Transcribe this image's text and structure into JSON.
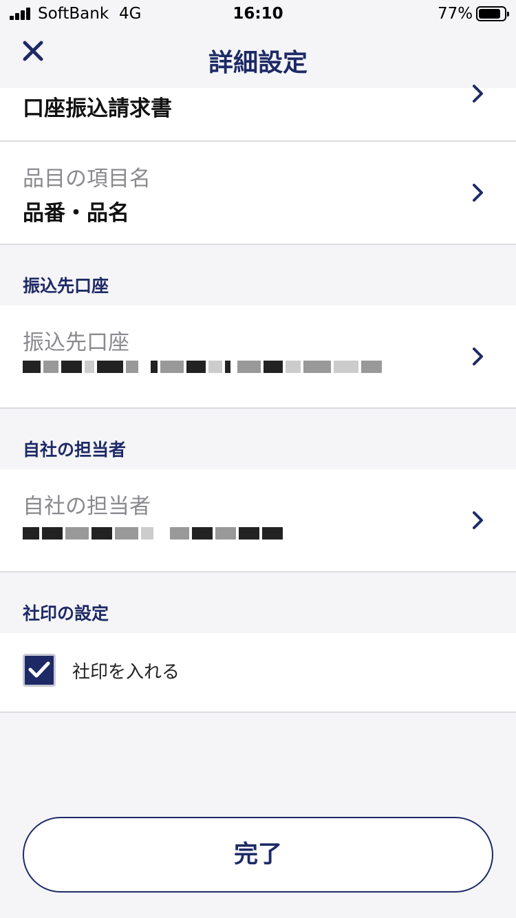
{
  "status_bar": {
    "carrier": "SoftBank",
    "network": "4G",
    "time": "16:10",
    "battery_percent": "77%",
    "battery_level": 0.77
  },
  "nav": {
    "title": "詳細設定",
    "close_icon": "close-icon"
  },
  "rows": {
    "invoice_type": {
      "value": "口座振込請求書"
    },
    "item_field_name": {
      "label": "品目の項目名",
      "value": "品番・品名"
    }
  },
  "sections": {
    "bank_account": {
      "header": "振込先口座",
      "label": "振込先口座",
      "value_redacted": true
    },
    "staff": {
      "header": "自社の担当者",
      "label": "自社の担当者",
      "value_redacted": true
    },
    "seal": {
      "header": "社印の設定",
      "checkbox_label": "社印を入れる",
      "checked": true
    }
  },
  "footer": {
    "done_label": "完了"
  },
  "colors": {
    "accent": "#1e2a66",
    "background": "#f5f5f8",
    "divider": "#dcdce2"
  }
}
